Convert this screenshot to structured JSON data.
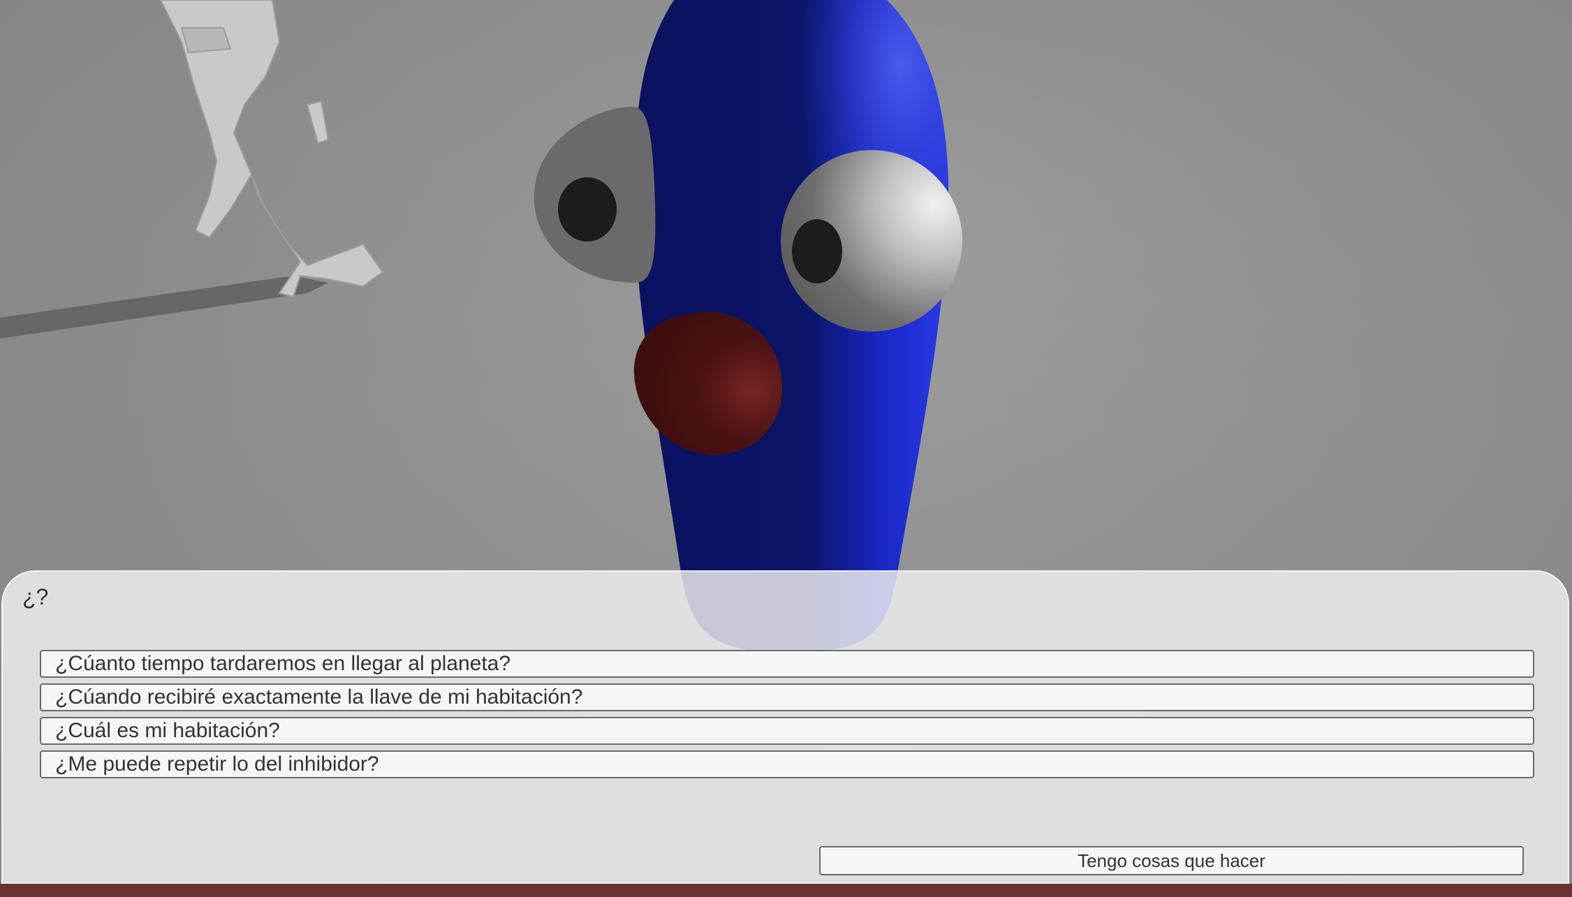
{
  "scene": {
    "character_name": "blue-capsule-npc",
    "colors": {
      "body": "#0c1466",
      "body_light": "#1f2fd6",
      "mouth": "#4a1212",
      "eye_white": "#cfcfcf",
      "pupil": "#1c1c1c",
      "floor": "#8f8f8f"
    }
  },
  "dialogue": {
    "speaker_line": "¿?",
    "options": [
      {
        "label": "¿Cúanto tiempo tardaremos en llegar al planeta?"
      },
      {
        "label": "¿Cúando recibiré exactamente la llave de mi habitación?"
      },
      {
        "label": "¿Cuál es mi habitación?"
      },
      {
        "label": "¿Me puede repetir lo del inhibidor?"
      }
    ],
    "leave_label": "Tengo cosas que hacer"
  }
}
